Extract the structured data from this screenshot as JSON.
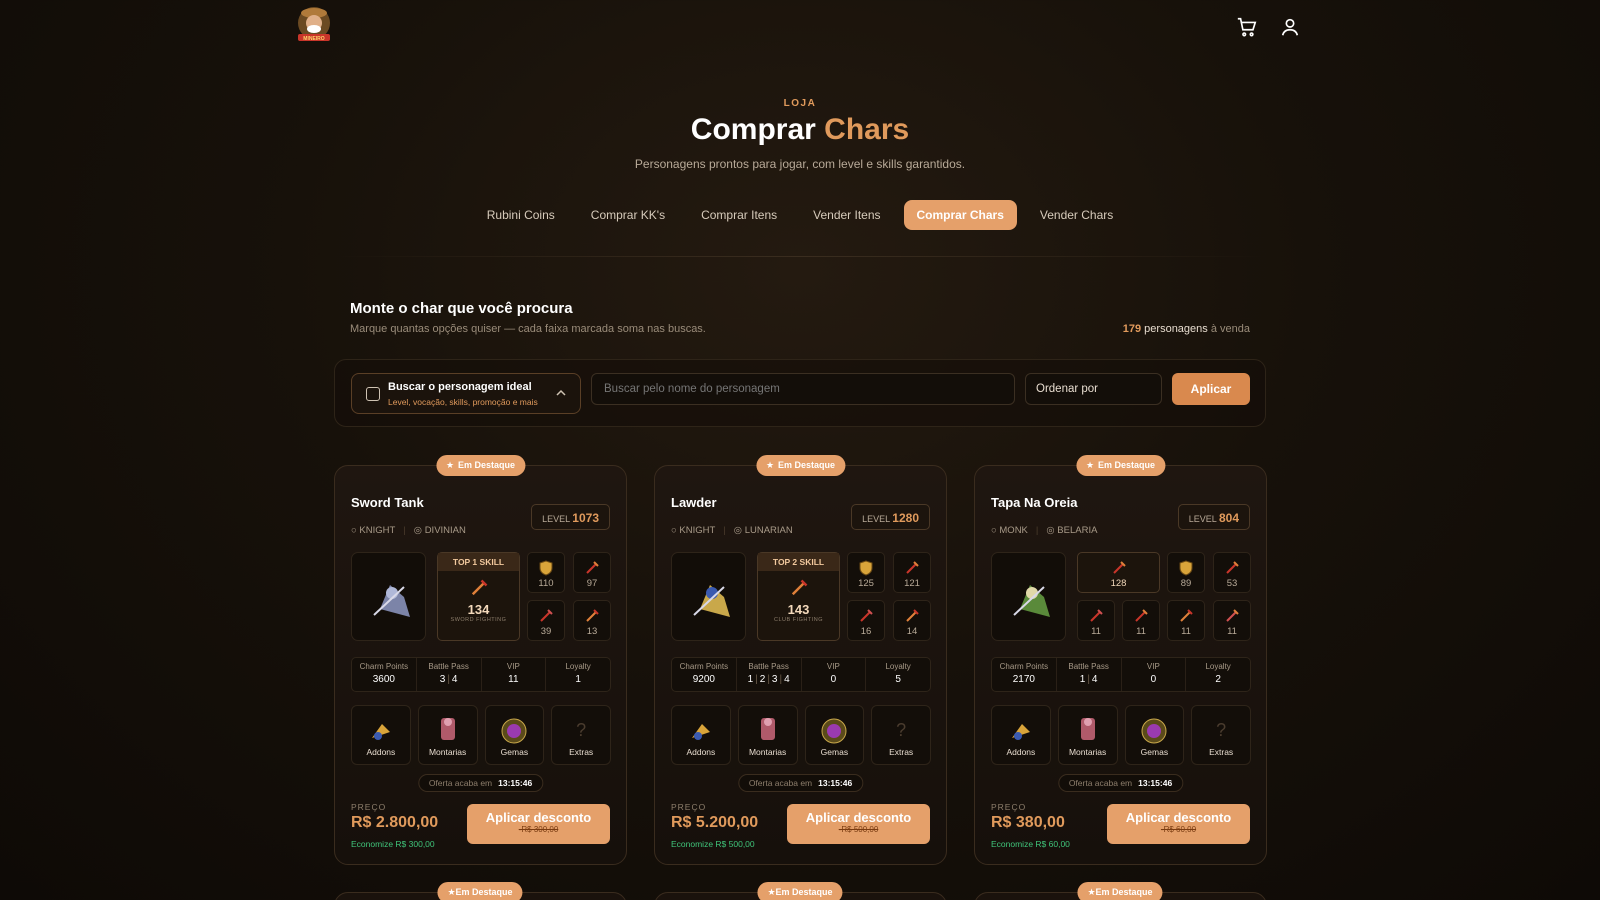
{
  "header": {
    "logo_text": "MINEIRO",
    "cart_icon": "cart-icon",
    "user_icon": "user-icon"
  },
  "hero": {
    "eyebrow": "LOJA",
    "title_prefix": "Comprar",
    "title_accent": "Chars",
    "subtitle": "Personagens prontos para jogar, com level e skills garantidos."
  },
  "tabs": [
    {
      "label": "Rubini Coins",
      "active": false
    },
    {
      "label": "Comprar KK's",
      "active": false
    },
    {
      "label": "Comprar Itens",
      "active": false
    },
    {
      "label": "Vender Itens",
      "active": false
    },
    {
      "label": "Comprar Chars",
      "active": true
    },
    {
      "label": "Vender Chars",
      "active": false
    }
  ],
  "section": {
    "title": "Monte o char que você procura",
    "subtitle": "Marque quantas opções quiser — cada faixa marcada soma nas buscas.",
    "count": "179",
    "count_label": "personagens",
    "count_suffix": "à venda"
  },
  "filter": {
    "ideal_title": "Buscar o personagem ideal",
    "ideal_sub": "Level, vocação, skills, promoção e mais",
    "search_placeholder": "Buscar pelo nome do personagem",
    "order_label": "Ordenar por",
    "apply_label": "Aplicar"
  },
  "labels": {
    "featured": "Em Destaque",
    "level": "LEVEL",
    "charm": "Charm Points",
    "battle": "Battle Pass",
    "vip": "VIP",
    "loyalty": "Loyalty",
    "addons": "Addons",
    "mounts": "Montarias",
    "gems": "Gemas",
    "extras": "Extras",
    "extras_q": "?",
    "offer": "Oferta acaba em",
    "price": "PREÇO",
    "discount_btn": "Aplicar desconto"
  },
  "cards": [
    {
      "name": "Sword Tank",
      "level": "1073",
      "vocation": "KNIGHT",
      "world": "DIVINIAN",
      "top_label": "TOP 1 SKILL",
      "top_value": "134",
      "top_sub": "SWORD FIGHTING",
      "skills": [
        "110",
        "97",
        "39",
        "13"
      ],
      "charm": "3600",
      "battle": [
        "3",
        "4"
      ],
      "vip": "11",
      "loyalty": "1",
      "timer": "13:15:46",
      "price": "R$ 2.800,00",
      "save": "Economize R$ 300,00",
      "old": "-R$ 300,00"
    },
    {
      "name": "Lawder",
      "level": "1280",
      "vocation": "KNIGHT",
      "world": "LUNARIAN",
      "top_label": "TOP 2 SKILL",
      "top_value": "143",
      "top_sub": "CLUB FIGHTING",
      "skills": [
        "125",
        "121",
        "16",
        "14"
      ],
      "charm": "9200",
      "battle": [
        "1",
        "2",
        "3",
        "4"
      ],
      "vip": "0",
      "loyalty": "5",
      "timer": "13:15:46",
      "price": "R$ 5.200,00",
      "save": "Economize R$ 500,00",
      "old": "-R$ 500,00"
    },
    {
      "name": "Tapa Na Oreia",
      "level": "804",
      "vocation": "MONK",
      "world": "BELARIA",
      "wide_value": "128",
      "skills": [
        "89",
        "53",
        "11",
        "11",
        "11",
        "11"
      ],
      "charm": "2170",
      "battle": [
        "1",
        "4"
      ],
      "vip": "0",
      "loyalty": "2",
      "timer": "13:15:46",
      "price": "R$ 380,00",
      "save": "Economize R$ 60,00",
      "old": "-R$ 60,00"
    }
  ],
  "colors": {
    "accent": "#e5a06a",
    "accent_text": "#e09a5c",
    "save": "#3fc47a",
    "bg": "#17110a"
  }
}
